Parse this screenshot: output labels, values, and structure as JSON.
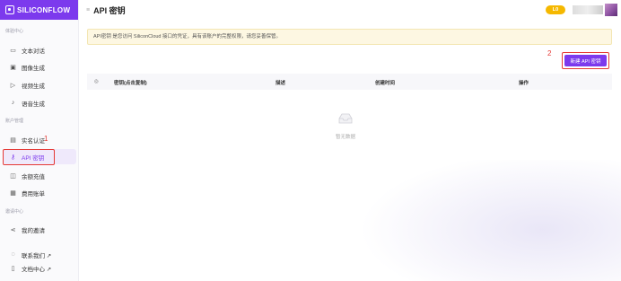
{
  "app": {
    "logo_text": "SILICONFLOW"
  },
  "header": {
    "title": "API 密钥",
    "level_badge": "L0"
  },
  "sidebar": {
    "sections": [
      {
        "title": "体验中心"
      },
      {
        "title": "账户管理"
      },
      {
        "title": "邀请中心"
      }
    ],
    "items": [
      {
        "label": "文本对话",
        "icon": "chat-icon"
      },
      {
        "label": "图像生成",
        "icon": "image-icon"
      },
      {
        "label": "视频生成",
        "icon": "video-icon"
      },
      {
        "label": "语音生成",
        "icon": "mic-icon"
      },
      {
        "label": "实名认证",
        "icon": "id-card-icon"
      },
      {
        "label": "API 密钥",
        "icon": "key-icon",
        "active": true
      },
      {
        "label": "余额充值",
        "icon": "wallet-icon"
      },
      {
        "label": "费用账单",
        "icon": "bill-icon"
      },
      {
        "label": "我的邀请",
        "icon": "share-icon"
      },
      {
        "label": "联系我们 ↗",
        "icon": "contact-icon"
      },
      {
        "label": "文档中心 ↗",
        "icon": "doc-icon"
      }
    ]
  },
  "notice": {
    "text": "API密钥 是您访问 SiliconCloud 接口的凭证，具有该账户的完整权限，请您妥善保管。"
  },
  "actions": {
    "create_label": "新建 API 密钥"
  },
  "table": {
    "columns": [
      "密钥(点击复制)",
      "描述",
      "创建时间",
      "操作"
    ],
    "empty_text": "暂无数据"
  },
  "annotations": {
    "one": "1",
    "two": "2"
  },
  "colors": {
    "brand": "#7c3aed",
    "annotation": "#e53935",
    "badge": "#f5b800"
  }
}
